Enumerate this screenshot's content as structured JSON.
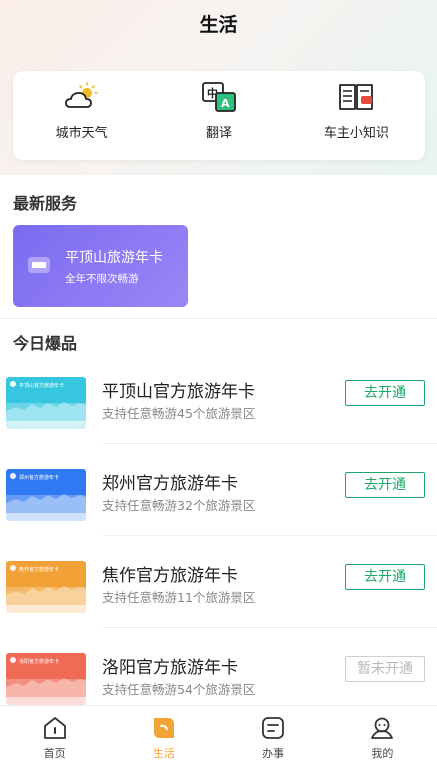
{
  "header": {
    "title": "生活"
  },
  "quick": [
    {
      "label": "城市天气",
      "icon": "weather-icon"
    },
    {
      "label": "翻译",
      "icon": "translate-icon"
    },
    {
      "label": "车主小知识",
      "icon": "book-icon"
    }
  ],
  "latest": {
    "title": "最新服务",
    "card": {
      "title": "平顶山旅游年卡",
      "subtitle": "全年不限次畅游"
    }
  },
  "hot": {
    "title": "今日爆品",
    "items": [
      {
        "name": "平顶山官方旅游年卡",
        "desc": "支持任意畅游45个旅游景区",
        "button": "去开通",
        "enabled": true,
        "thumb_text": "平顶山官方旅游年卡",
        "color": "#37c6e0"
      },
      {
        "name": "郑州官方旅游年卡",
        "desc": "支持任意畅游32个旅游景区",
        "button": "去开通",
        "enabled": true,
        "thumb_text": "郑州官方旅游年卡",
        "color": "#2f7af2"
      },
      {
        "name": "焦作官方旅游年卡",
        "desc": "支持任意畅游11个旅游景区",
        "button": "去开通",
        "enabled": true,
        "thumb_text": "焦作官方旅游年卡",
        "color": "#f2a136"
      },
      {
        "name": "洛阳官方旅游年卡",
        "desc": "支持任意畅游54个旅游景区",
        "button": "暂未开通",
        "enabled": false,
        "thumb_text": "洛阳官方旅游年卡",
        "color": "#f06a55"
      }
    ]
  },
  "tabs": [
    {
      "label": "首页",
      "icon": "home-icon",
      "active": false
    },
    {
      "label": "生活",
      "icon": "life-icon",
      "active": true
    },
    {
      "label": "办事",
      "icon": "affairs-icon",
      "active": false
    },
    {
      "label": "我的",
      "icon": "profile-icon",
      "active": false
    }
  ],
  "colors": {
    "accent": "#1ca86b",
    "tab_active": "#f2a534",
    "card_purple": "#8a77f3"
  }
}
